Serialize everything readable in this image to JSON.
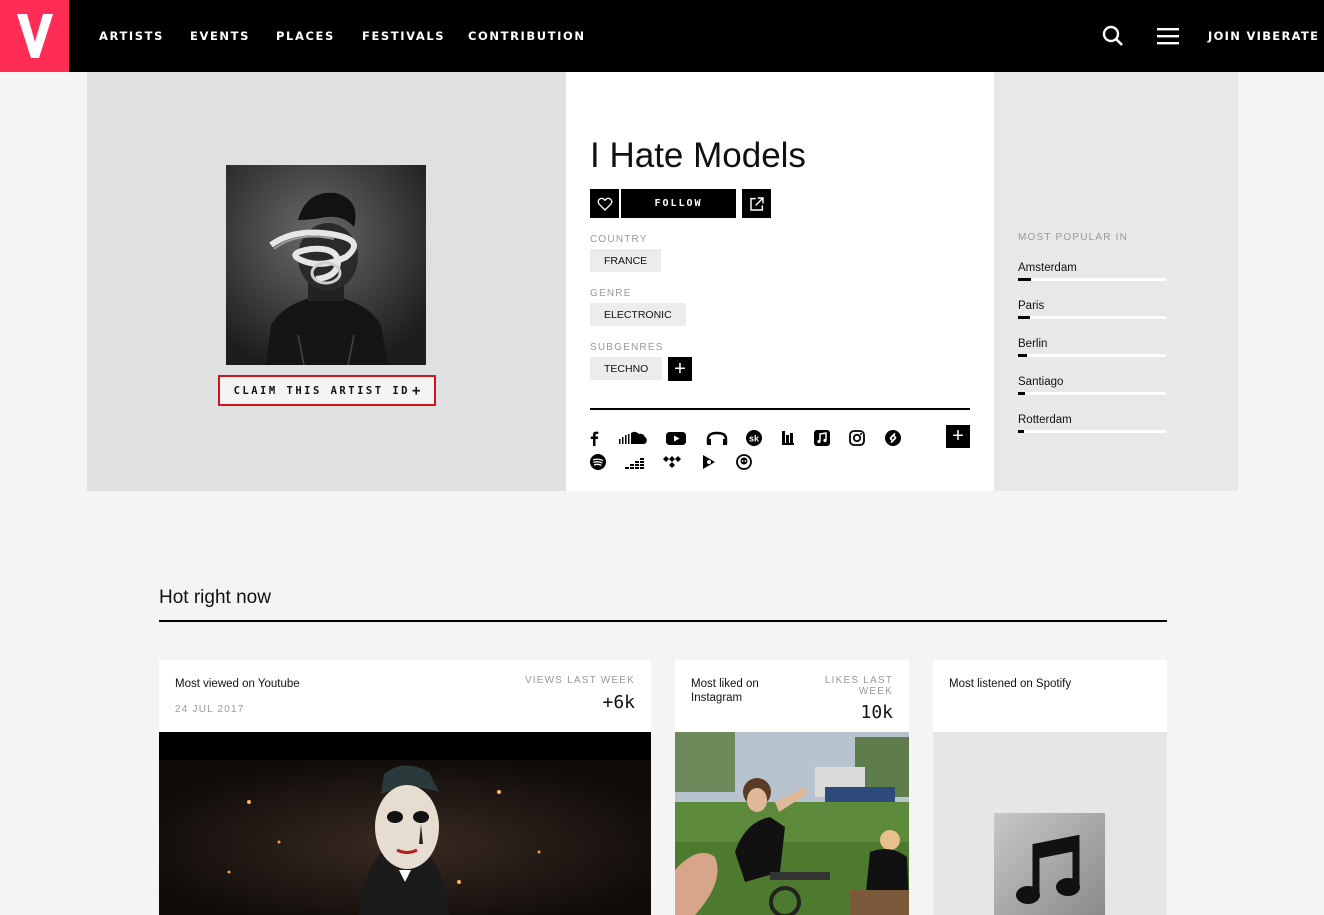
{
  "nav": {
    "logo_letter": "V",
    "links": [
      "ARTISTS",
      "EVENTS",
      "PLACES",
      "FESTIVALS",
      "CONTRIBUTION"
    ],
    "join": "JOIN VIBERATE"
  },
  "artist": {
    "name": "I Hate Models",
    "claim_label": "CLAIM THIS ARTIST ID",
    "claim_plus": "+",
    "follow_label": "FOLLOW",
    "country_label": "COUNTRY",
    "country": "FRANCE",
    "genre_label": "GENRE",
    "genre": "ELECTRONIC",
    "subgenres_label": "SUBGENRES",
    "subgenre": "TECHNO",
    "add_symbol": "+",
    "social_icons": [
      "facebook-icon",
      "soundcloud-icon",
      "youtube-icon",
      "mixcloud-icon",
      "songkick-icon",
      "beatport-icon",
      "apple-music-icon",
      "instagram-icon",
      "shazam-icon",
      "spotify-icon",
      "deezer-icon",
      "tidal-icon",
      "google-play-icon",
      "napster-icon"
    ]
  },
  "popular": {
    "title": "MOST POPULAR IN",
    "cities": [
      {
        "name": "Amsterdam",
        "level": 0.09
      },
      {
        "name": "Paris",
        "level": 0.08
      },
      {
        "name": "Berlin",
        "level": 0.06
      },
      {
        "name": "Santiago",
        "level": 0.05
      },
      {
        "name": "Rotterdam",
        "level": 0.04
      }
    ]
  },
  "hot": {
    "title": "Hot right now",
    "youtube": {
      "title": "Most viewed on Youtube",
      "date": "24 JUL 2017",
      "metric_label": "VIEWS LAST WEEK",
      "metric_value": "+6k"
    },
    "instagram": {
      "title_line1": "Most liked on",
      "title_line2": "Instagram",
      "metric_label_line1": "LIKES LAST",
      "metric_label_line2": "WEEK",
      "metric_value": "10k"
    },
    "spotify": {
      "title": "Most listened on Spotify"
    }
  },
  "colors": {
    "brand": "#ff2d55",
    "highlight": "#d0151b",
    "nav_bg": "#000000"
  }
}
